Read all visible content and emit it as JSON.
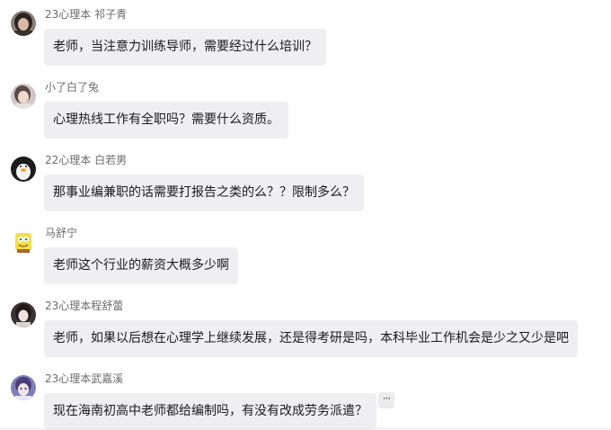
{
  "messages": [
    {
      "sender": "23心理本 祁子青",
      "text": "老师，当注意力训练导师，需要经过什么培训？",
      "avatar": "avatar-portrait-dark-hair"
    },
    {
      "sender": "小了白了兔",
      "text": "心理热线工作有全职吗？需要什么资质。",
      "avatar": "avatar-portrait-light"
    },
    {
      "sender": "22心理本 白若男",
      "text": "那事业编兼职的话需要打报告之类的么？？限制多么？",
      "avatar": "avatar-penguin"
    },
    {
      "sender": "马舒宁",
      "text": "老师这个行业的薪资大概多少啊",
      "avatar": "avatar-sponge-cartoon"
    },
    {
      "sender": "23心理本程舒蕾",
      "text": "老师，如果以后想在心理学上继续发展，还是得考研是吗，本科毕业工作机会是少之又少是吧",
      "avatar": "avatar-portrait-pale"
    },
    {
      "sender": "23心理本武嘉溪",
      "text": "现在海南初高中老师都给编制吗，有没有改成劳务派遣？",
      "avatar": "avatar-anime-purple"
    }
  ],
  "more_button_label": "···",
  "colors": {
    "bubble_bg": "#efeff2",
    "sender_text": "#6b6b6b",
    "message_text": "#1b1b1b"
  }
}
